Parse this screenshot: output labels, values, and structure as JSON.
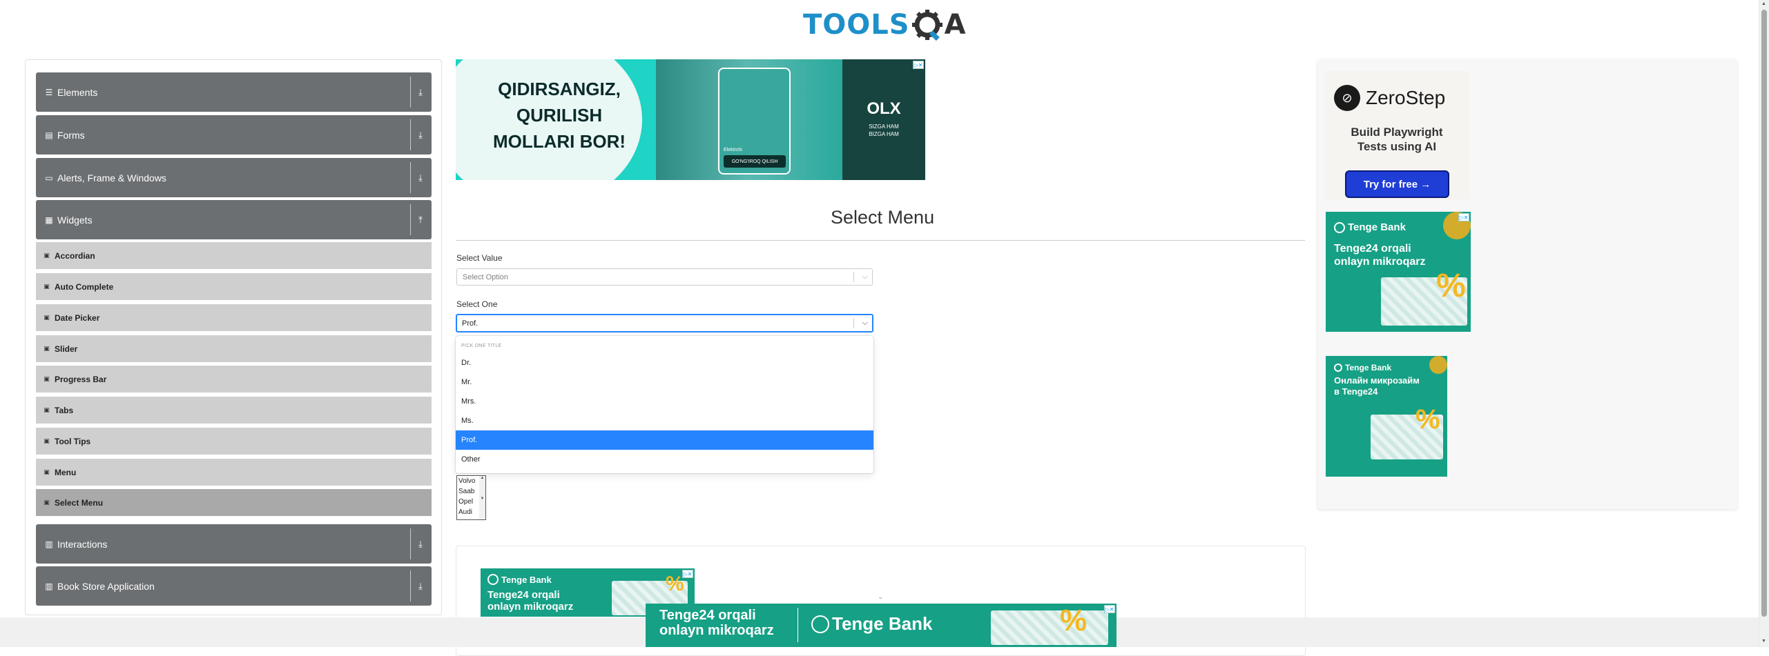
{
  "header": {
    "logo_part1": "TOOLS",
    "logo_part2": "A"
  },
  "sidebar": {
    "groups": [
      {
        "label": "Elements",
        "icon": "list-icon"
      },
      {
        "label": "Forms",
        "icon": "form-icon"
      },
      {
        "label": "Alerts, Frame & Windows",
        "icon": "window-icon"
      },
      {
        "label": "Widgets",
        "icon": "grid-icon"
      },
      {
        "label": "Interactions",
        "icon": "hand-icon"
      },
      {
        "label": "Book Store Application",
        "icon": "book-icon"
      }
    ],
    "widget_items": [
      {
        "label": "Accordian"
      },
      {
        "label": "Auto Complete"
      },
      {
        "label": "Date Picker"
      },
      {
        "label": "Slider"
      },
      {
        "label": "Progress Bar"
      },
      {
        "label": "Tabs"
      },
      {
        "label": "Tool Tips"
      },
      {
        "label": "Menu"
      },
      {
        "label": "Select Menu"
      }
    ]
  },
  "main": {
    "title": "Select Menu",
    "select_value": {
      "label": "Select Value",
      "placeholder": "Select Option"
    },
    "select_one": {
      "label": "Select One",
      "value": "Prof.",
      "group_title": "Pick one title",
      "options": [
        "Dr.",
        "Mr.",
        "Mrs.",
        "Ms.",
        "Prof.",
        "Other"
      ],
      "selected": "Prof."
    },
    "cars": [
      "Volvo",
      "Saab",
      "Opel",
      "Audi"
    ]
  },
  "ads": {
    "olx": {
      "headline_1": "QIDIRSANGIZ,",
      "headline_2": "QURILISH",
      "headline_3": "MOLLARI BOR!",
      "phone_label": "Elektrchi",
      "phone_button": "GO'NG'IROQ QILISH",
      "brand": "OLX",
      "brand_tag_1": "SIZGA HAM",
      "brand_tag_2": "BIZGA HAM"
    },
    "zerostep": {
      "name": "ZeroStep",
      "tagline_1": "Build Playwright",
      "tagline_2": "Tests using AI",
      "cta": "Try for free →"
    },
    "tenge": {
      "brand": "Tenge Bank",
      "headline_uz_1": "Tenge24 orqali",
      "headline_uz_2": "onlayn mikroqarz",
      "headline_ru_1": "Онлайн микрозайм",
      "headline_ru_2": "в Tenge24",
      "percent": "%"
    }
  },
  "colors": {
    "sidebar_header": "#6b6f72",
    "sidebar_item": "#cfcfcf",
    "sidebar_active": "#a9a9a9",
    "select_focus": "#2684ff",
    "logo_blue": "#1d8fc9",
    "tenge_green": "#16a085",
    "zerostep_button": "#1f3ed6"
  }
}
